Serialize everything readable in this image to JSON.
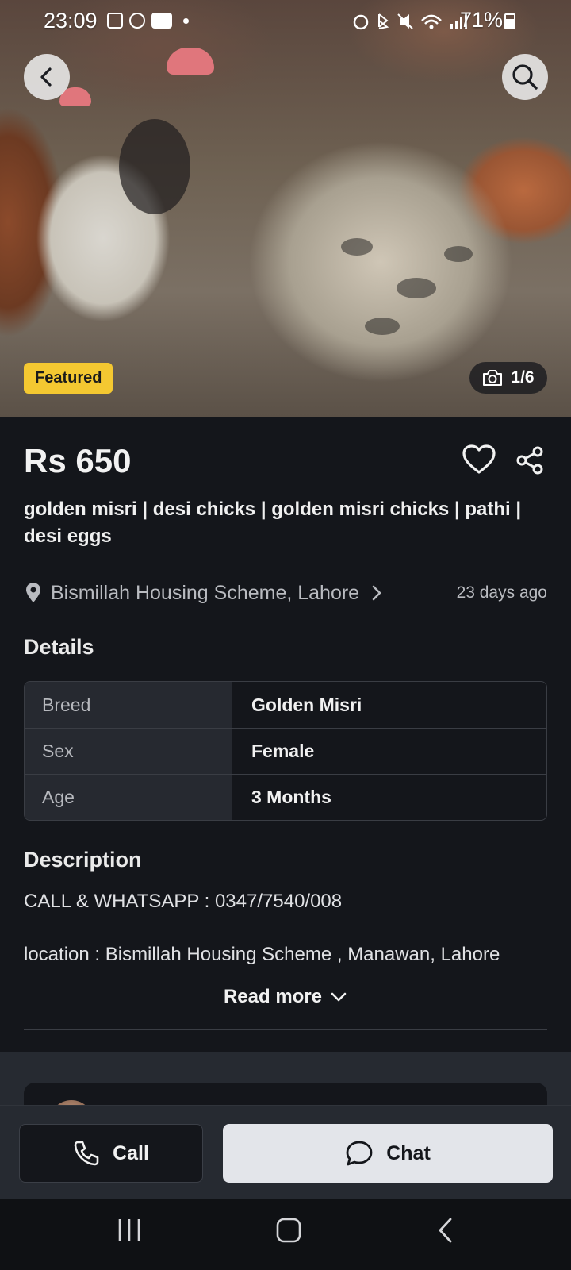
{
  "status_bar": {
    "time": "23:09",
    "battery": "71%"
  },
  "hero": {
    "featured_label": "Featured",
    "photo_counter": "1/6"
  },
  "listing": {
    "price": "Rs 650",
    "title": "golden misri | desi chicks |  golden misri chicks | pathi | desi eggs",
    "location": "Bismillah Housing Scheme, Lahore",
    "posted": "23 days ago"
  },
  "details": {
    "heading": "Details",
    "rows": [
      {
        "key": "Breed",
        "value": "Golden Misri"
      },
      {
        "key": "Sex",
        "value": "Female"
      },
      {
        "key": "Age",
        "value": "3 Months"
      }
    ]
  },
  "description": {
    "heading": "Description",
    "line1": "CALL & WHATSAPP :  0347/7540/008",
    "line2": "location : Bismillah Housing Scheme , Manawan, Lahore",
    "read_more": "Read more"
  },
  "actions": {
    "call_label": "Call",
    "chat_label": "Chat"
  },
  "colors": {
    "background": "#14161b",
    "featured_badge": "#f4c831",
    "chat_button": "#e3e5ea"
  }
}
